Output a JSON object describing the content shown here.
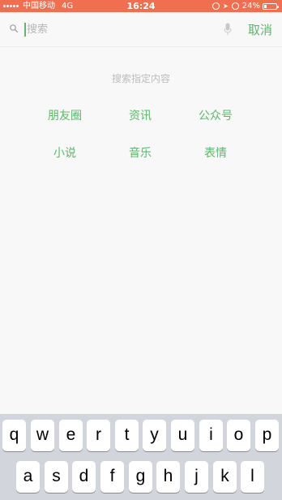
{
  "status_bar": {
    "carrier": "中国移动",
    "network": "4G",
    "time": "16:24",
    "battery": "24%",
    "battery_level": 0.24
  },
  "search": {
    "placeholder": "搜索",
    "value": "",
    "cancel_label": "取消"
  },
  "content": {
    "hint": "搜索指定内容",
    "filters": [
      "朋友圈",
      "资讯",
      "公众号",
      "小说",
      "音乐",
      "表情"
    ]
  },
  "keyboard": {
    "row1": [
      "q",
      "w",
      "e",
      "r",
      "t",
      "y",
      "u",
      "i",
      "o",
      "p"
    ],
    "row2": [
      "a",
      "s",
      "d",
      "f",
      "g",
      "h",
      "j",
      "k",
      "l"
    ]
  },
  "colors": {
    "accent": "#5fb56a",
    "status_bar": "#ef6f50"
  }
}
